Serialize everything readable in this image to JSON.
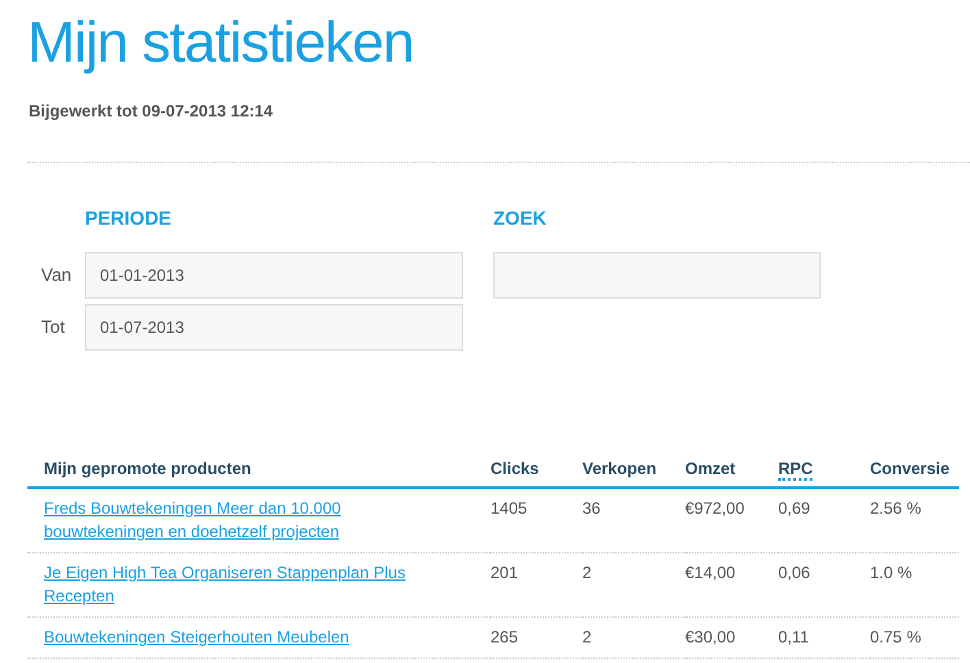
{
  "title": "Mijn statistieken",
  "updated": "Bijgewerkt tot 09-07-2013 12:14",
  "periode": {
    "heading": "PERIODE",
    "fields": [
      {
        "label": "Van",
        "value": "01-01-2013"
      },
      {
        "label": "Tot",
        "value": "01-07-2013"
      }
    ]
  },
  "zoek": {
    "heading": "ZOEK"
  },
  "table": {
    "columns": [
      "Mijn gepromote producten",
      "Clicks",
      "Verkopen",
      "Omzet",
      "RPC",
      "Conversie"
    ],
    "rows": [
      {
        "product": "Freds Bouwtekeningen Meer dan 10.000 bouwtekeningen en doehetzelf projecten",
        "clicks": "1405",
        "verkopen": "36",
        "omzet": "€972,00",
        "rpc": "0,69",
        "conversie": "2.56 %"
      },
      {
        "product": "Je Eigen High Tea Organiseren Stappenplan Plus Recepten",
        "clicks": "201",
        "verkopen": "2",
        "omzet": "€14,00",
        "rpc": "0,06",
        "conversie": "1.0 %"
      },
      {
        "product": "Bouwtekeningen Steigerhouten Meubelen",
        "clicks": "265",
        "verkopen": "2",
        "omzet": "€30,00",
        "rpc": "0,11",
        "conversie": "0.75 %"
      }
    ]
  }
}
